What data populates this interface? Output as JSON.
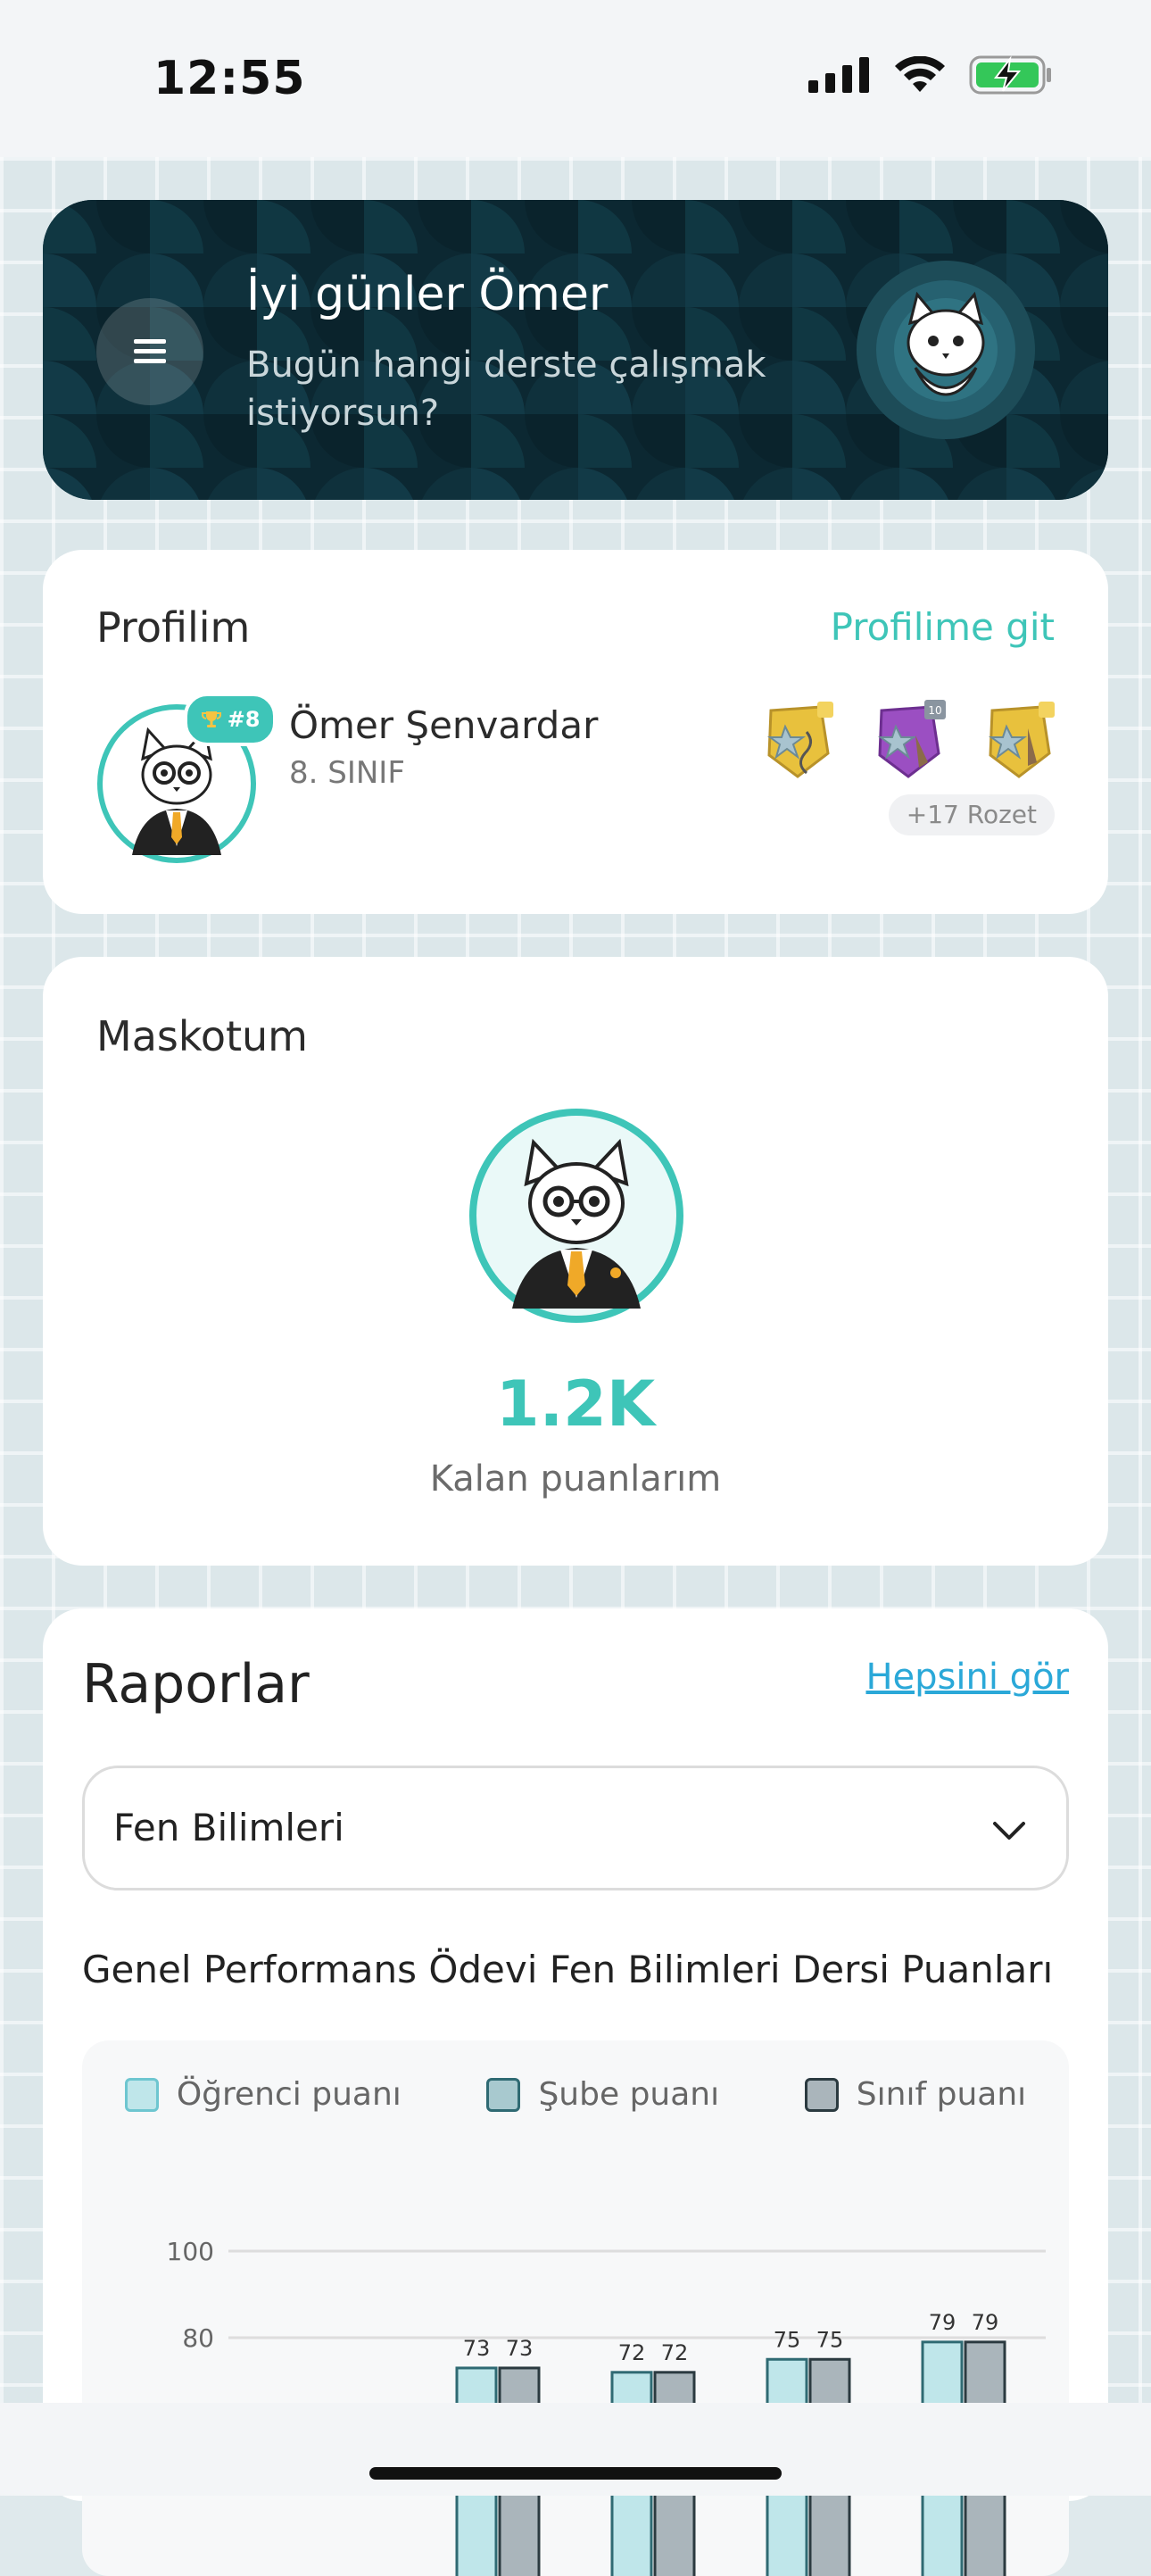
{
  "status_bar": {
    "time": "12:55"
  },
  "header": {
    "greeting": "İyi günler Ömer",
    "subtitle": "Bugün hangi derste çalışmak istiyorsun?"
  },
  "profile": {
    "title": "Profilim",
    "link": "Profilime git",
    "rank": "#8",
    "name": "Ömer Şenvardar",
    "class": "8. SINIF",
    "badge_levels": [
      "",
      "10",
      ""
    ],
    "more_badges": "+17 Rozet"
  },
  "mascot": {
    "title": "Maskotum",
    "points": "1.2K",
    "points_label": "Kalan puanlarım"
  },
  "reports": {
    "title": "Raporlar",
    "see_all": "Hepsini gör",
    "selected_subject": "Fen Bilimleri",
    "chart_heading": "Genel Performans Ödevi Fen Bilimleri Dersi Puanları"
  },
  "colors": {
    "accent": "#3ec5b8",
    "link": "#2aa8d8",
    "hero_bg": "#0e2f3a",
    "student_bar": "#bfe6ea",
    "section_bar": "#a8c9cf",
    "class_bar": "#aab5bb"
  },
  "chart_data": {
    "type": "bar",
    "legend": [
      "Öğrenci puanı",
      "Şube puanı",
      "Sınıf puanı"
    ],
    "y_ticks": [
      100,
      80
    ],
    "ylim": [
      0,
      100
    ],
    "grid": true,
    "legend_position": "top",
    "groups": [
      {
        "values": [
          73,
          73
        ]
      },
      {
        "values": [
          72,
          72
        ]
      },
      {
        "values": [
          75,
          75
        ]
      },
      {
        "values": [
          79,
          79
        ]
      }
    ]
  }
}
